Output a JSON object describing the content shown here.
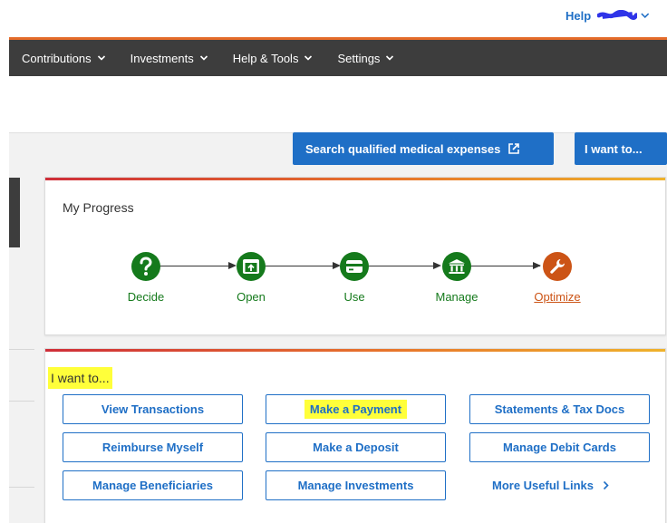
{
  "header": {
    "help_label": "Help",
    "user_name_redacted": true
  },
  "nav": {
    "items": [
      {
        "label": "Contributions"
      },
      {
        "label": "Investments"
      },
      {
        "label": "Help & Tools"
      },
      {
        "label": "Settings"
      }
    ]
  },
  "toolbar": {
    "search_label": "Search qualified medical expenses",
    "search_icon": "external-link-icon",
    "iwant_label": "I want to..."
  },
  "progress": {
    "title": "My Progress",
    "steps": [
      {
        "label": "Decide",
        "icon": "question-icon",
        "state": "complete"
      },
      {
        "label": "Open",
        "icon": "open-account-icon",
        "state": "complete"
      },
      {
        "label": "Use",
        "icon": "card-icon",
        "state": "complete"
      },
      {
        "label": "Manage",
        "icon": "bank-icon",
        "state": "complete"
      },
      {
        "label": "Optimize",
        "icon": "wrench-icon",
        "state": "current"
      }
    ]
  },
  "actions": {
    "title": "I want to...",
    "buttons": [
      {
        "label": "View Transactions"
      },
      {
        "label": "Make a Payment"
      },
      {
        "label": "Statements & Tax Docs"
      },
      {
        "label": "Reimburse Myself"
      },
      {
        "label": "Make a Deposit"
      },
      {
        "label": "Manage Debit Cards"
      },
      {
        "label": "Manage Beneficiaries"
      },
      {
        "label": "Manage Investments"
      }
    ],
    "more_links_label": "More Useful Links"
  },
  "colors": {
    "brand_blue": "#1f6fc6",
    "nav_dark": "#3d3d3d",
    "step_green": "#157a1c",
    "step_orange": "#cc5416",
    "highlight": "#ffff3a"
  }
}
